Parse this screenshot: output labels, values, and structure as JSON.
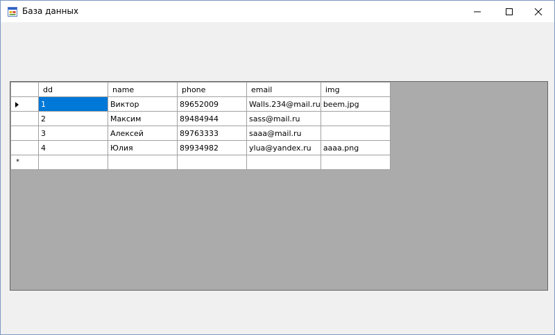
{
  "window": {
    "title": "База данных",
    "icon": "form-icon",
    "controls": [
      "minimize-icon",
      "maximize-icon",
      "close-icon"
    ]
  },
  "grid": {
    "columns": [
      "dd",
      "name",
      "phone",
      "email",
      "img"
    ],
    "rows": [
      {
        "dd": "1",
        "name": "Виктор",
        "phone": "89652009",
        "email": "Walls.234@mail.ru",
        "img": "beem.jpg"
      },
      {
        "dd": "2",
        "name": "Максим",
        "phone": "89484944",
        "email": "sass@mail.ru",
        "img": ""
      },
      {
        "dd": "3",
        "name": "Алексей",
        "phone": "89763333",
        "email": "saaa@mail.ru",
        "img": ""
      },
      {
        "dd": "4",
        "name": "Юлия",
        "phone": "89934982",
        "email": "ylua@yandex.ru",
        "img": "aaaa.png"
      }
    ],
    "current_row_marker": "▶",
    "new_row_marker": "*",
    "selected_cell_color": "#0078d7",
    "background_color": "#ababab"
  }
}
